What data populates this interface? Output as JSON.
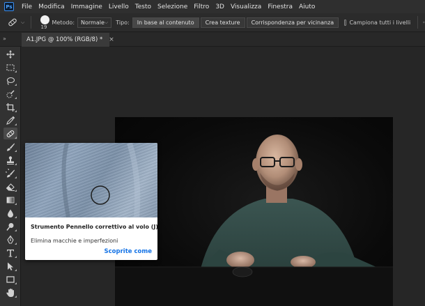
{
  "app": {
    "logo": "Ps"
  },
  "menu": [
    "File",
    "Modifica",
    "Immagine",
    "Livello",
    "Testo",
    "Selezione",
    "Filtro",
    "3D",
    "Visualizza",
    "Finestra",
    "Aiuto"
  ],
  "options": {
    "brush_size": "19",
    "metodo_label": "Metodo:",
    "metodo_value": "Normale",
    "tipo_label": "Tipo:",
    "tipo_buttons": [
      "In base al contenuto",
      "Crea texture",
      "Corrispondenza per vicinanza"
    ],
    "sample_all_label": "Campiona tutti i livelli"
  },
  "document": {
    "tab_title": "A1.JPG @ 100% (RGB/8) *",
    "close": "×"
  },
  "tabbar": {
    "collapse": "»"
  },
  "tooltip": {
    "title": "Strumento Pennello correttivo al volo (J)",
    "description": "Elimina macchie e imperfezioni",
    "link": "Scoprite come"
  },
  "colors": {
    "accent": "#1473e6",
    "menubar": "#2f2f2f",
    "panel": "#323232",
    "canvas_bg": "#262626"
  }
}
